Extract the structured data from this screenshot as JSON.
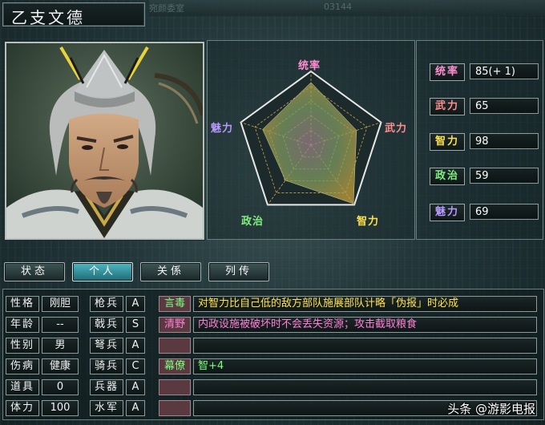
{
  "officer_name": "乙支文德",
  "background_labels": [
    "宛颜委室",
    "03144"
  ],
  "tabs": [
    {
      "label": "状态",
      "active": false
    },
    {
      "label": "个人",
      "active": true
    },
    {
      "label": "关係",
      "active": false
    },
    {
      "label": "列传",
      "active": false
    }
  ],
  "radar": {
    "labels": {
      "leadership": "统率",
      "war": "武力",
      "intelligence": "智力",
      "politics": "政治",
      "charisma": "魅力"
    },
    "values": {
      "leadership": 85,
      "war": 65,
      "intelligence": 98,
      "politics": 59,
      "charisma": 69
    },
    "max": 100
  },
  "stats": [
    {
      "label": "统率",
      "value": "85(+ 1)",
      "color": "#ff8fd0"
    },
    {
      "label": "武力",
      "value": "65",
      "color": "#ff8f8f"
    },
    {
      "label": "智力",
      "value": "98",
      "color": "#ffe24a"
    },
    {
      "label": "政治",
      "value": "59",
      "color": "#7ff07f"
    },
    {
      "label": "魅力",
      "value": "69",
      "color": "#b89bff"
    }
  ],
  "profile": [
    {
      "label": "性格",
      "value": "刚胆"
    },
    {
      "label": "年龄",
      "value": "--"
    },
    {
      "label": "性别",
      "value": "男"
    },
    {
      "label": "伤病",
      "value": "健康"
    },
    {
      "label": "道具",
      "value": "0"
    },
    {
      "label": "体力",
      "value": "100"
    }
  ],
  "aptitudes": [
    {
      "label": "枪兵",
      "grade": "A"
    },
    {
      "label": "戟兵",
      "grade": "S"
    },
    {
      "label": "弩兵",
      "grade": "A"
    },
    {
      "label": "骑兵",
      "grade": "C"
    },
    {
      "label": "兵器",
      "grade": "A"
    },
    {
      "label": "水军",
      "grade": "A"
    }
  ],
  "skills": [
    {
      "name": "言毒",
      "desc": "对智力比自己低的敌方部队施展部队计略「伪报」时必成",
      "name_color": "#7dff7d",
      "desc_color": "#ffe14a"
    },
    {
      "name": "清野",
      "desc": "内政设施被破坏时不会丢失资源；攻击截取粮食",
      "name_color": "#ff7fd6",
      "desc_color": "#ff7fd6"
    },
    {
      "name": "",
      "desc": "",
      "name_color": "#ffffff",
      "desc_color": "#ffffff"
    },
    {
      "name": "幕僚",
      "desc": "智+4",
      "name_color": "#7dff7d",
      "desc_color": "#7dff7d"
    },
    {
      "name": "",
      "desc": "",
      "name_color": "#ffffff",
      "desc_color": "#ffffff"
    },
    {
      "name": "",
      "desc": "",
      "name_color": "#ffffff",
      "desc_color": "#ffffff"
    }
  ],
  "watermark": "头条 @游影电报"
}
